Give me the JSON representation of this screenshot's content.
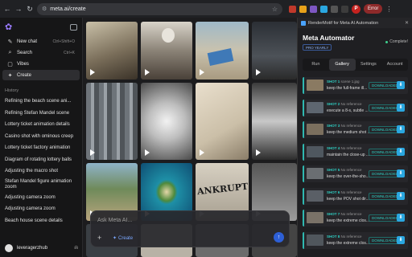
{
  "browser": {
    "url": "meta.ai/create",
    "error_label": "Error",
    "profile_initial": "P"
  },
  "sidebar": {
    "nav": [
      {
        "label": "New chat",
        "shortcut": "Ctrl+Shift+O",
        "icon": "compose-icon"
      },
      {
        "label": "Search",
        "shortcut": "Ctrl+K",
        "icon": "search-icon"
      },
      {
        "label": "Vibes",
        "shortcut": "",
        "icon": "vibes-icon"
      },
      {
        "label": "Create",
        "shortcut": "",
        "icon": "create-icon"
      }
    ],
    "history_label": "History",
    "history": [
      "Refining the beach scene ani...",
      "Refining Stefan Mandel scene",
      "Lottery ticket animation details",
      "Casino shot with ominous creep",
      "Lottery ticket factory animation",
      "Diagram of rotating lottery balls",
      "Adjusting the macro shot",
      "Stefan Mandel figure animation zoom",
      "Adjusting camera zoom",
      "Adjusting camera zoom",
      "Beach house scene details"
    ],
    "username": "leveragerzhub"
  },
  "composer": {
    "placeholder": "Ask Meta AI...",
    "create_label": "Create"
  },
  "extension": {
    "header_title": "RenderMotif for Meta AI Automation",
    "title": "Meta Automator",
    "status": "Complete!",
    "badge": "PRO YEARLY",
    "tabs": [
      "Run",
      "Gallery",
      "Settings",
      "Account"
    ],
    "active_tab": "Gallery",
    "shots": [
      {
        "label": "SHOT 1",
        "ref": "scene 1.jpg",
        "desc": "keep the full-frame ill...",
        "status": "DOWNLOADED"
      },
      {
        "label": "SHOT 2",
        "ref": "No reference",
        "desc": "execute a 8-s, subtle ...",
        "status": "DOWNLOADED"
      },
      {
        "label": "SHOT 3",
        "ref": "No reference",
        "desc": "keep the medium shot ...",
        "status": "DOWNLOADED"
      },
      {
        "label": "SHOT 4",
        "ref": "No reference",
        "desc": "maintain the close-up ...",
        "status": "DOWNLOADED"
      },
      {
        "label": "SHOT 5",
        "ref": "No reference",
        "desc": "keep the over-the-sho...",
        "status": "DOWNLOADED"
      },
      {
        "label": "SHOT 6",
        "ref": "No reference",
        "desc": "keep the POV shot dir...",
        "status": "DOWNLOADED"
      },
      {
        "label": "SHOT 7",
        "ref": "No reference",
        "desc": "keep the extreme clos...",
        "status": "DOWNLOADED"
      },
      {
        "label": "SHOT 8",
        "ref": "No reference",
        "desc": "keep the extreme clos...",
        "status": "DOWNLOADED"
      }
    ]
  },
  "gallery_images": [
    "lottery-desk-photo",
    "figure-at-window-photo",
    "beach-lottery-ticket-photo",
    "casino-photo",
    "factory-room-photo",
    "lottery-balls-photo",
    "handwritten-notes-photo",
    "figure-closeup-photo",
    "beach-hut-photo",
    "island-aerial-photo",
    "bankrupt-headline-photo",
    "hall-photo"
  ],
  "gallery_text": {
    "headline_fragment": "ANKRUPT"
  },
  "colors": {
    "accent": "#2fd0c4",
    "brand": "#9b7cff",
    "send": "#2d5fd6"
  }
}
